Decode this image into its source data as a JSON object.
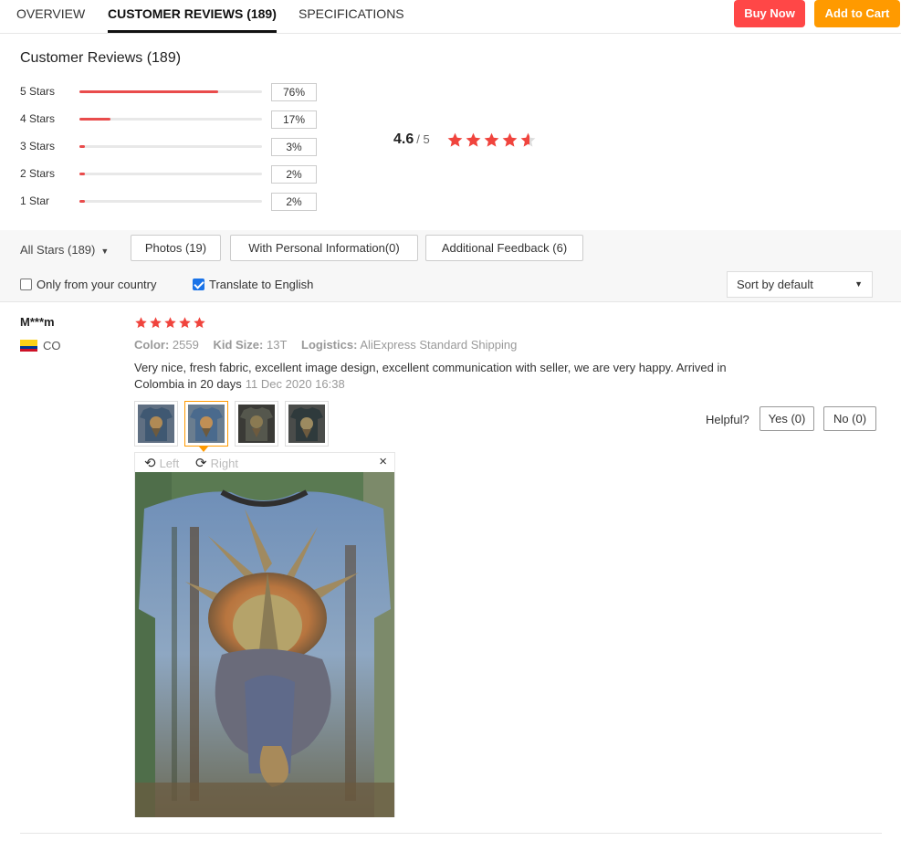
{
  "tabs": [
    {
      "label": "OVERVIEW"
    },
    {
      "label": "CUSTOMER REVIEWS (189)"
    },
    {
      "label": "SPECIFICATIONS"
    }
  ],
  "actions": {
    "buy_now": "Buy Now",
    "add_to_cart": "Add to Cart"
  },
  "colors": {
    "buy_now": "#ff4747",
    "add_to_cart": "#ff9a00",
    "star": "#f0443d",
    "bar": "#e94c4c"
  },
  "reviews_heading": "Customer Reviews (189)",
  "distribution": [
    {
      "label": "5 Stars",
      "percent_text": "76%",
      "percent": 76
    },
    {
      "label": "4 Stars",
      "percent_text": "17%",
      "percent": 17
    },
    {
      "label": "3 Stars",
      "percent_text": "3%",
      "percent": 3
    },
    {
      "label": "2 Stars",
      "percent_text": "2%",
      "percent": 2
    },
    {
      "label": "1 Star",
      "percent_text": "2%",
      "percent": 2
    }
  ],
  "overall": {
    "score": "4.6",
    "out_of": "/ 5",
    "stars": 4.6
  },
  "filters": {
    "all_stars": "All Stars (189)",
    "photos": "Photos (19)",
    "personal": "With Personal Information(0)",
    "additional": "Additional Feedback (6)",
    "only_country": "Only from your country",
    "only_country_checked": false,
    "translate": "Translate to English",
    "translate_checked": true,
    "sort": "Sort by default"
  },
  "review": {
    "user": "M***m",
    "country": "CO",
    "stars": 5,
    "color_label": "Color:",
    "color_value": "2559",
    "kid_size_label": "Kid Size:",
    "kid_size_value": "13T",
    "logistics_label": "Logistics:",
    "logistics_value": "AliExpress Standard Shipping",
    "text": "Very nice, fresh fabric, excellent image design, excellent communication with seller, we are very happy. Arrived in Colombia in 20 days",
    "date": "11 Dec 2020 16:38",
    "helpful_label": "Helpful?",
    "yes": "Yes (0)",
    "no": "No (0)",
    "viewer": {
      "left": "Left",
      "right": "Right",
      "close": "×"
    }
  }
}
